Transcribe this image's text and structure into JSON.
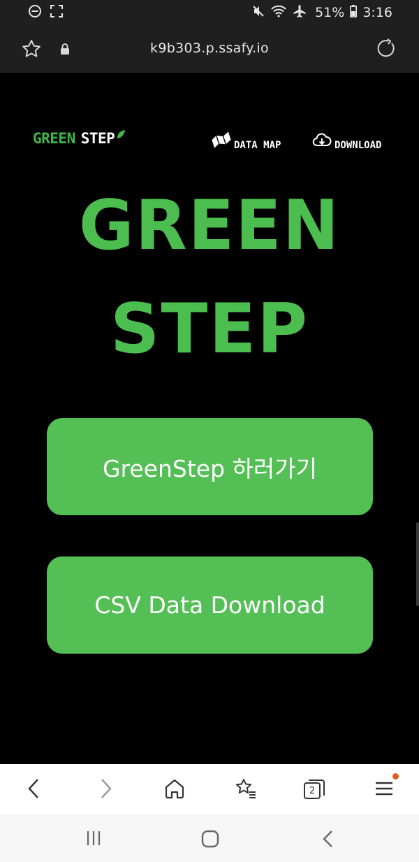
{
  "status_bar": {
    "battery": "51%",
    "time": "3:16",
    "left_icons": [
      "do-not-disturb-icon",
      "screenshot-icon"
    ],
    "right_icons": [
      "mute-icon",
      "wifi-icon",
      "airplane-icon",
      "battery-icon"
    ]
  },
  "browser": {
    "url": "k9b303.p.ssafy.io",
    "icons": [
      "star-icon",
      "lock-icon",
      "reload-icon"
    ]
  },
  "nav": {
    "logo_green": "GREEN",
    "logo_white": "STEP",
    "links": [
      {
        "label": "DATA MAP",
        "icon": "map-icon"
      },
      {
        "label": "DOWNLOAD",
        "icon": "cloud-download-icon"
      }
    ]
  },
  "hero": {
    "line1": "GREEN",
    "line2": "STEP"
  },
  "buttons": {
    "greenstep": "GreenStep 하러가기",
    "csv": "CSV Data Download"
  },
  "toolbar": {
    "tab_count": "2",
    "icons": [
      "back-icon",
      "forward-icon",
      "home-icon",
      "bookmarks-icon",
      "tabs-icon",
      "menu-icon"
    ]
  },
  "system_nav": {
    "icons": [
      "recent-apps-icon",
      "home-icon",
      "back-icon"
    ]
  },
  "colors": {
    "brand_green": "#53bf54",
    "hero_green": "#4cbd4f",
    "background": "#000000",
    "notification_dot": "#e85a1a"
  }
}
